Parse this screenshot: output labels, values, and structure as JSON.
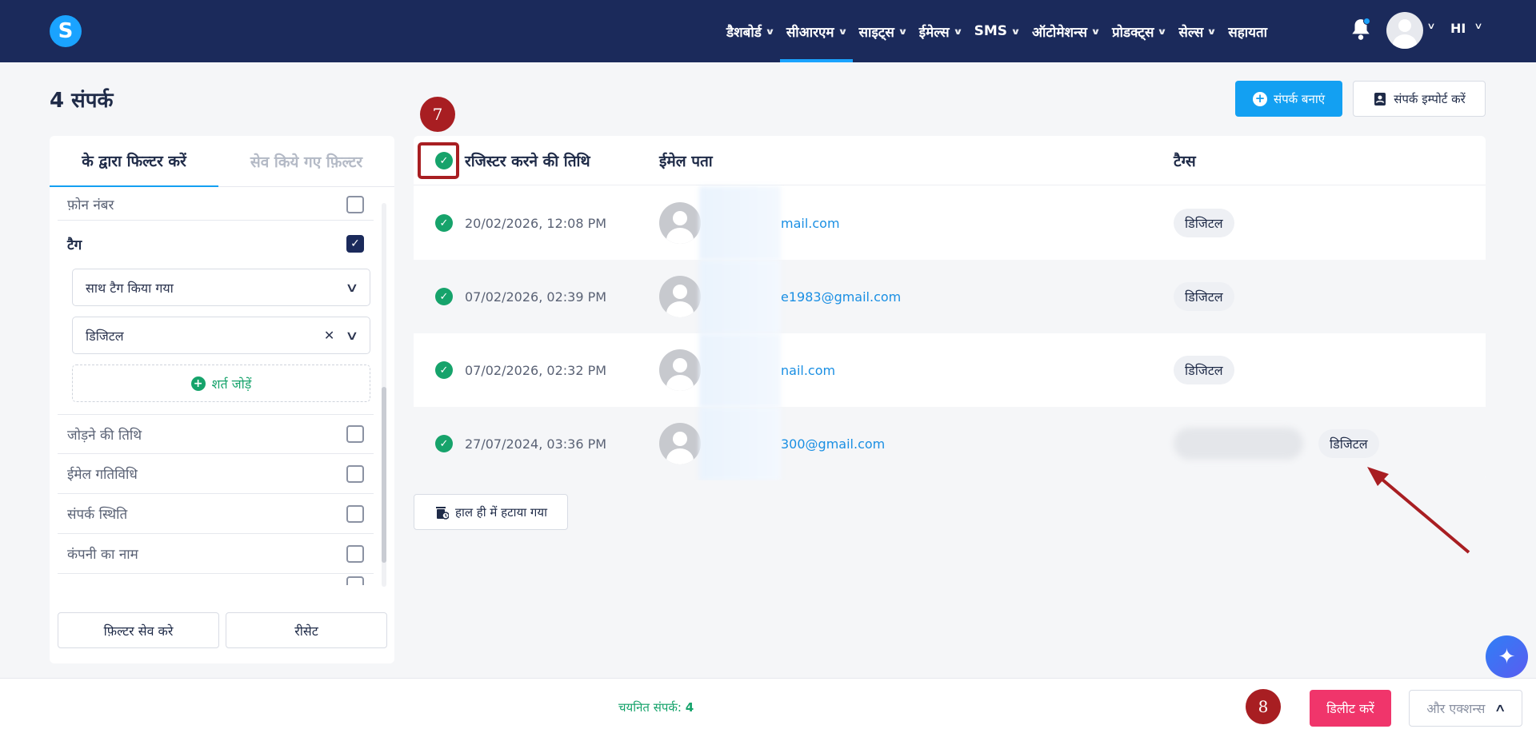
{
  "nav": {
    "items": [
      {
        "label": "डैशबोर्ड",
        "chevron": true,
        "active": false
      },
      {
        "label": "सीआरएम",
        "chevron": true,
        "active": true
      },
      {
        "label": "साइट्स",
        "chevron": true,
        "active": false
      },
      {
        "label": "ईमेल्स",
        "chevron": true,
        "active": false
      },
      {
        "label": "SMS",
        "chevron": true,
        "active": false
      },
      {
        "label": "ऑटोमेशन्स",
        "chevron": true,
        "active": false
      },
      {
        "label": "प्रोडक्ट्स",
        "chevron": true,
        "active": false
      },
      {
        "label": "सेल्स",
        "chevron": true,
        "active": false
      },
      {
        "label": "सहायता",
        "chevron": false,
        "active": false
      }
    ],
    "language": "HI",
    "logo_letter": "S"
  },
  "page": {
    "title": "4 संपर्क",
    "create_label": "संपर्क बनाएं",
    "import_label": "संपर्क इम्पोर्ट करें"
  },
  "filters": {
    "tab_active": "के द्वारा फिल्टर करें",
    "tab_saved": "सेव किये गए फ़िल्टर",
    "phone_label": "फ़ोन नंबर",
    "tag_label": "टैग",
    "tag_condition": "साथ टैग किया गया",
    "tag_value": "डिजिटल",
    "add_condition": "शर्त जोड़ें",
    "options": [
      "जोड़ने की तिथि",
      "ईमेल गतिविधि",
      "संपर्क स्थिति",
      "कंपनी का नाम"
    ],
    "save_label": "फ़िल्टर सेव करे",
    "reset_label": "रीसेट"
  },
  "table": {
    "headers": {
      "date": "रजिस्टर करने की तिथि",
      "email": "ईमेल पता",
      "tags": "टैग्स"
    },
    "rows": [
      {
        "date": "20/02/2026, 12:08 PM",
        "email_visible": "mail.com",
        "tag": "डिजिटल"
      },
      {
        "date": "07/02/2026, 02:39 PM",
        "email_visible": "e1983@gmail.com",
        "tag": "डिजिटल"
      },
      {
        "date": "07/02/2026, 02:32 PM",
        "email_visible": "nail.com",
        "tag": "डिजिटल"
      },
      {
        "date": "27/07/2024, 03:36 PM",
        "email_visible": "300@gmail.com",
        "tag": "डिजिटल"
      }
    ]
  },
  "recently_removed": "हाल ही में हटाया गया",
  "annotations": {
    "step7": "7",
    "step8": "8",
    "color": "#a81e22"
  },
  "bottom": {
    "selected_label": "चयनित संपर्क:",
    "selected_count": "4",
    "delete_label": "डिलीट करें",
    "more_label": "और एक्शन्स"
  },
  "colors": {
    "nav_bg": "#1b2a5b",
    "accent": "#13a0f2",
    "success": "#16a36b",
    "danger": "#f0356b"
  }
}
